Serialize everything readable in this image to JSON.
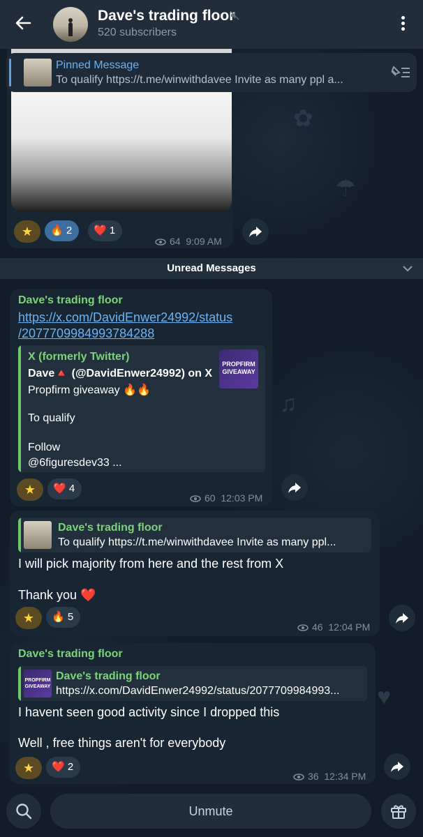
{
  "header": {
    "title": "Dave's trading floor",
    "subtitle": "520 subscribers"
  },
  "pinned": {
    "label": "Pinned Message",
    "text": "To qualify   https://t.me/winwithdavee   Invite as many ppl a..."
  },
  "post1": {
    "reactions": [
      {
        "emoji": "🔥",
        "count": "2"
      },
      {
        "emoji": "❤️",
        "count": "1"
      }
    ],
    "views": "64",
    "time": "9:09 AM"
  },
  "unread_label": "Unread Messages",
  "post2": {
    "sender": "Dave's trading floor",
    "link": "https://x.com/DavidEnwer24992/status/2077709984993784288",
    "link_line1": "https://x.com/DavidEnwer24992/status",
    "link_line2": "/2077709984993784288",
    "preview": {
      "site": "X (formerly Twitter)",
      "title": "Dave🔺 (@DavidEnwer24992) on X",
      "line1": "Propfirm giveaway 🔥🔥",
      "line2": "To qualify",
      "line3": "Follow",
      "line4": "@6figuresdev33 ...",
      "thumb_text": "PROPFIRM GIVEAWAY"
    },
    "reactions": [
      {
        "emoji": "❤️",
        "count": "4"
      }
    ],
    "views": "60",
    "time": "12:03 PM"
  },
  "post3": {
    "reply_name": "Dave's trading floor",
    "reply_text": "To qualify   https://t.me/winwithdavee   Invite as many ppl...",
    "line1": "I will pick majority from here and the rest from X",
    "line2": "Thank you ❤️",
    "reactions": [
      {
        "emoji": "🔥",
        "count": "5"
      }
    ],
    "views": "46",
    "time": "12:04 PM"
  },
  "post4": {
    "sender": "Dave's trading floor",
    "reply_name": "Dave's trading floor",
    "reply_text": "https://x.com/DavidEnwer24992/status/2077709984993...",
    "reply_thumb_text": "PROPFIRM GIVEAWAY",
    "line1": "I havent seen good activity since I dropped this",
    "line2": "Well , free things aren't for everybody",
    "reactions": [
      {
        "emoji": "❤️",
        "count": "2"
      }
    ],
    "views": "36",
    "time": "12:34 PM"
  },
  "bottom": {
    "unmute_label": "Unmute"
  },
  "colors": {
    "accent": "#6ab3f3",
    "sender_green": "#7dd37a",
    "bubble": "#182533",
    "header": "#212d3b"
  },
  "icons": [
    "back-arrow-icon",
    "mute-icon",
    "more-vert-icon",
    "unpin-icon",
    "star-icon",
    "eye-icon",
    "share-icon",
    "chevron-down-icon",
    "search-icon",
    "gift-icon"
  ]
}
